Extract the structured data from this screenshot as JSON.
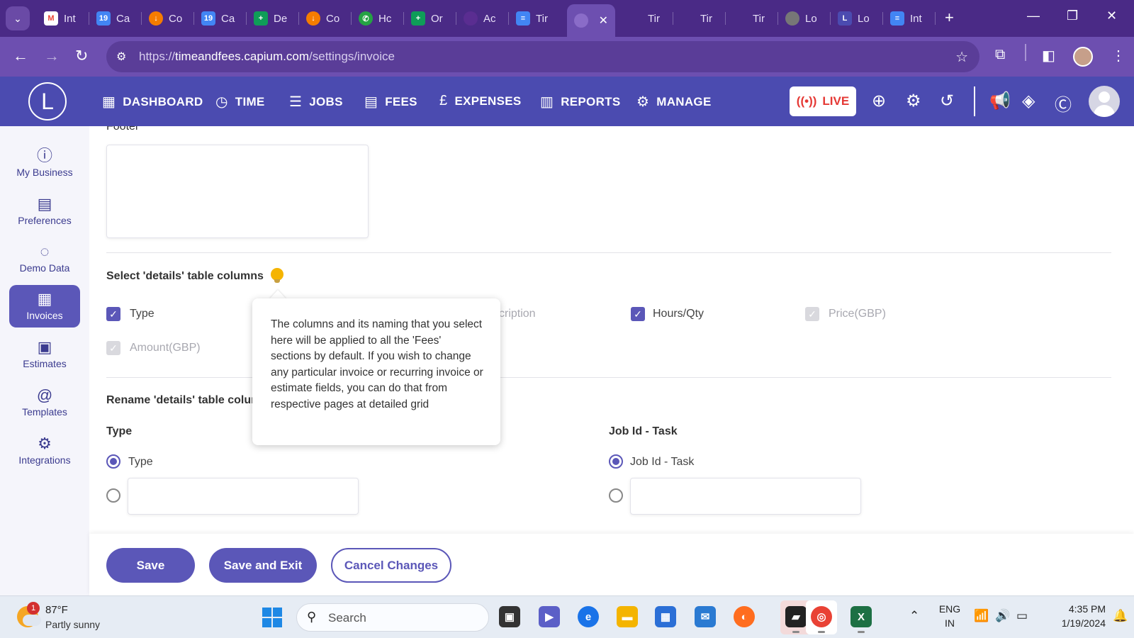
{
  "browser": {
    "tabs": [
      {
        "label": "Int",
        "icon": "gmail-icon",
        "color": "#ea4335"
      },
      {
        "label": "Ca",
        "icon": "calendar-icon",
        "color": "#4285f4"
      },
      {
        "label": "Co",
        "icon": "orange-app-icon",
        "color": "#f57c00"
      },
      {
        "label": "Ca",
        "icon": "calendar-icon",
        "color": "#4285f4"
      },
      {
        "label": "De",
        "icon": "sheets-icon",
        "color": "#0f9d58"
      },
      {
        "label": "Co",
        "icon": "orange-app-icon",
        "color": "#f57c00"
      },
      {
        "label": "Hc",
        "icon": "phone-icon",
        "color": "#25a244"
      },
      {
        "label": "Or",
        "icon": "sheets-icon",
        "color": "#0f9d58"
      },
      {
        "label": "Ac",
        "icon": "purple-app-icon",
        "color": "#5a2d91"
      },
      {
        "label": "Tir",
        "icon": "docs-icon",
        "color": "#4285f4"
      }
    ],
    "active_tab_icon": "capium-icon",
    "tabs_after": [
      {
        "label": "Tir"
      },
      {
        "label": "Tir"
      },
      {
        "label": "Tir"
      },
      {
        "label": "Lo",
        "icon": "globe-icon",
        "color": "#777777"
      },
      {
        "label": "Lo",
        "icon": "capium-l-icon",
        "color": "#4b4bb0"
      },
      {
        "label": "Int",
        "icon": "docs-icon",
        "color": "#4285f4"
      }
    ],
    "url_prefix": "https://",
    "url_host": "timeandfees.capium.com",
    "url_path": "/settings/invoice"
  },
  "app": {
    "logo_letter": "L",
    "nav": [
      {
        "label": "DASHBOARD",
        "icon": "grid-icon"
      },
      {
        "label": "TIME",
        "icon": "clock-icon"
      },
      {
        "label": "JOBS",
        "icon": "list-icon"
      },
      {
        "label": "FEES",
        "icon": "document-icon"
      },
      {
        "label": "EXPENSES",
        "icon": "pound-icon"
      },
      {
        "label": "REPORTS",
        "icon": "chart-icon"
      },
      {
        "label": "MANAGE",
        "icon": "users-gear-icon"
      }
    ],
    "live_label": "LIVE",
    "brand_color": "#4b4bb0",
    "accent_color": "#5b57b8"
  },
  "sidebar": {
    "items": [
      {
        "label": "My Business",
        "icon": "info-icon",
        "active": false
      },
      {
        "label": "Preferences",
        "icon": "preferences-icon",
        "active": false
      },
      {
        "label": "Demo Data",
        "icon": "refresh-icon",
        "active": false
      },
      {
        "label": "Invoices",
        "icon": "invoice-icon",
        "active": true
      },
      {
        "label": "Estimates",
        "icon": "clipboard-icon",
        "active": false
      },
      {
        "label": "Templates",
        "icon": "at-icon",
        "active": false
      },
      {
        "label": "Integrations",
        "icon": "integrations-icon",
        "active": false
      }
    ]
  },
  "main": {
    "footer_label": "Footer",
    "select_section_title": "Select 'details' table columns",
    "columns": [
      {
        "label": "Type",
        "checked": true,
        "disabled": false
      },
      {
        "label": "cription",
        "checked": false,
        "disabled": false
      },
      {
        "label": "Hours/Qty",
        "checked": true,
        "disabled": false
      },
      {
        "label": "Price(GBP)",
        "checked": true,
        "disabled": true
      },
      {
        "label": "Amount(GBP)",
        "checked": true,
        "disabled": true
      }
    ],
    "rename_section_title": "Rename 'details' table colun",
    "rename_fields": [
      {
        "title": "Type",
        "default_option": "Type",
        "custom_value": ""
      },
      {
        "title": "Job Id - Task",
        "default_option": "Job Id - Task",
        "custom_value": ""
      }
    ],
    "tooltip_text": "The columns and its naming that you select here will be applied to all the 'Fees' sections by default. If you wish to change any particular invoice or recurring invoice or estimate fields, you can do that from respective pages at detailed grid"
  },
  "actions": {
    "save": "Save",
    "save_exit": "Save and Exit",
    "cancel": "Cancel Changes"
  },
  "taskbar": {
    "weather_badge": "1",
    "weather_temp": "87°F",
    "weather_desc": "Partly sunny",
    "search_placeholder": "Search",
    "lang_top": "ENG",
    "lang_bottom": "IN",
    "time": "4:35 PM",
    "date": "1/19/2024"
  }
}
